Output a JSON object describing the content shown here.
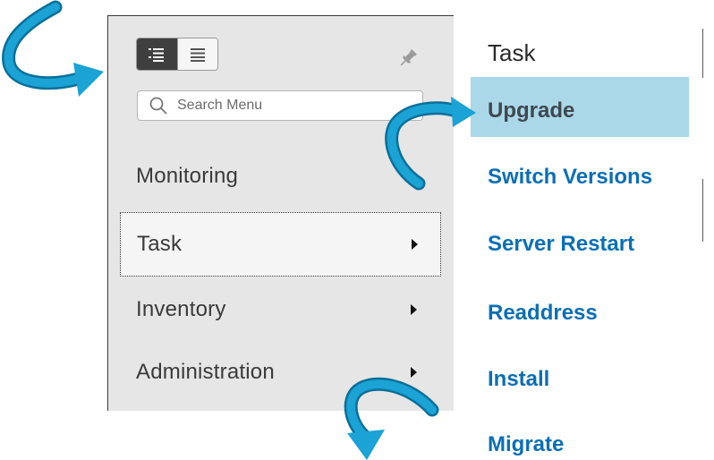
{
  "menu": {
    "search": {
      "placeholder": "Search Menu"
    },
    "items": [
      {
        "label": "Monitoring",
        "has_arrow": false,
        "selected": false
      },
      {
        "label": "Task",
        "has_arrow": true,
        "selected": true
      },
      {
        "label": "Inventory",
        "has_arrow": true,
        "selected": false
      },
      {
        "label": "Administration",
        "has_arrow": true,
        "selected": false
      }
    ]
  },
  "submenu": {
    "title": "Task",
    "items": [
      {
        "label": "Upgrade",
        "active": true
      },
      {
        "label": "Switch Versions",
        "active": false
      },
      {
        "label": "Server Restart",
        "active": false
      },
      {
        "label": "Readdress",
        "active": false
      },
      {
        "label": "Install",
        "active": false
      },
      {
        "label": "Migrate",
        "active": false
      }
    ]
  },
  "colors": {
    "menu_background": "#e6e6e6",
    "link_blue": "#0b6fb5",
    "highlight": "#aad8e8",
    "annotation_arrow": "#1aa3d4"
  },
  "icons": [
    "list-view-icon",
    "compact-list-icon",
    "pin-icon",
    "search-icon",
    "chevron-right-icon",
    "annotation-arrow-icon"
  ]
}
